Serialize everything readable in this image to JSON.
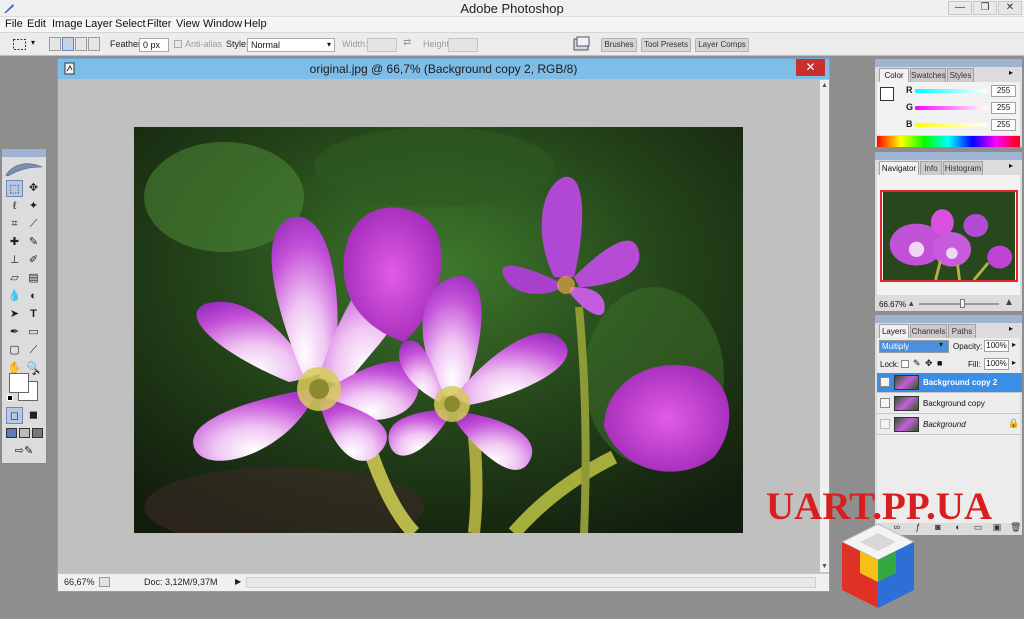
{
  "app": {
    "title": "Adobe Photoshop",
    "window_buttons": [
      "—",
      "❐",
      "✕"
    ]
  },
  "menu": [
    "File",
    "Edit",
    "Image",
    "Layer",
    "Select",
    "Filter",
    "View",
    "Window",
    "Help"
  ],
  "options_bar": {
    "feather_label": "Feather:",
    "feather_value": "0 px",
    "antialias_label": "Anti-alias",
    "style_label": "Style:",
    "style_value": "Normal",
    "width_label": "Width:",
    "height_label": "Height:"
  },
  "palette_well": [
    "Brushes",
    "Tool Presets",
    "Layer Comps"
  ],
  "document": {
    "title": "original.jpg @ 66,7% (Background copy 2, RGB/8)",
    "zoom": "66,67%",
    "doc_info": "Doc: 3,12M/9,37M"
  },
  "color_palette": {
    "tabs": [
      "Color",
      "Swatches",
      "Styles"
    ],
    "channels": [
      {
        "label": "R",
        "value": "255"
      },
      {
        "label": "G",
        "value": "255"
      },
      {
        "label": "B",
        "value": "255"
      }
    ]
  },
  "navigator_palette": {
    "tabs": [
      "Navigator",
      "Info",
      "Histogram"
    ],
    "zoom": "66.67%"
  },
  "layers_palette": {
    "tabs": [
      "Layers",
      "Channels",
      "Paths"
    ],
    "blend_mode": "Multiply",
    "opacity_label": "Opacity:",
    "opacity_value": "100%",
    "lock_label": "Lock:",
    "fill_label": "Fill:",
    "fill_value": "100%",
    "layers": [
      {
        "name": "Background copy 2"
      },
      {
        "name": "Background copy"
      },
      {
        "name": "Background"
      }
    ]
  },
  "watermark": {
    "text": "UART.PP.UA"
  },
  "colors": {
    "doc_titlebar": "#7ebde8",
    "selected_layer": "#3b8ee6",
    "close_button": "#c9302c",
    "watermark": "#d81f1f"
  }
}
